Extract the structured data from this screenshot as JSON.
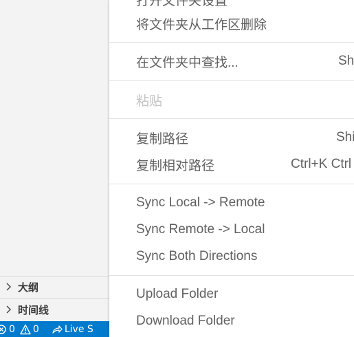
{
  "sidebar": {
    "panels": [
      {
        "label": "大纲"
      },
      {
        "label": "时间线"
      }
    ]
  },
  "statusbar": {
    "errors": "0",
    "warnings": "0",
    "live_share": "Live S"
  },
  "menu": {
    "items": [
      {
        "label": "打开文件夹设置",
        "shortcut": ""
      },
      {
        "label": "将文件夹从工作区删除",
        "shortcut": ""
      },
      {
        "label": "在文件夹中查找...",
        "shortcut": "Sh"
      },
      {
        "label": "粘贴",
        "shortcut": "",
        "disabled": true
      },
      {
        "label": "复制路径",
        "shortcut": "Shi"
      },
      {
        "label": "复制相对路径",
        "shortcut": "Ctrl+K Ctrl"
      },
      {
        "label": "Sync Local -> Remote",
        "shortcut": ""
      },
      {
        "label": "Sync Remote -> Local",
        "shortcut": ""
      },
      {
        "label": "Sync Both Directions",
        "shortcut": ""
      },
      {
        "label": "Upload Folder",
        "shortcut": ""
      },
      {
        "label": "Download Folder",
        "shortcut": ""
      }
    ]
  },
  "colors": {
    "statusbar_bg": "#007acc",
    "menu_text": "#616161",
    "disabled_text": "#c4c4c4"
  }
}
